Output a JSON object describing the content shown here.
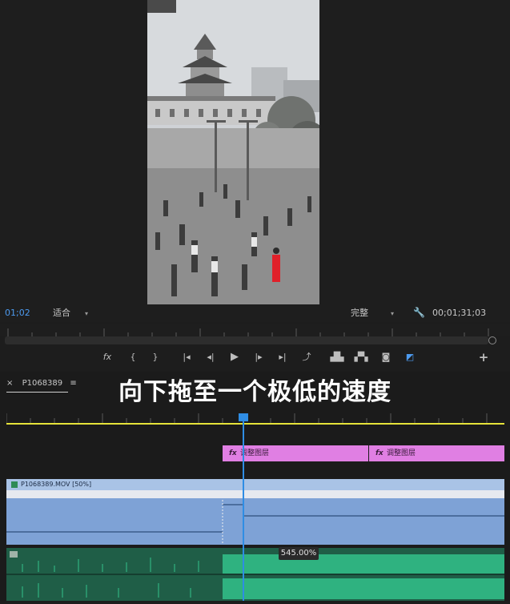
{
  "monitor": {
    "timecode_current": "01;02",
    "fit_label": "适合",
    "quality_label": "完整",
    "timecode_duration": "00;01;31;03",
    "colors": {
      "timecode": "#4d9bf0",
      "accent_red_figure": "#e0202a"
    }
  },
  "transport": {
    "buttons": [
      "fx-icon",
      "mark-in-icon",
      "mark-out-icon",
      "go-to-in-icon",
      "step-back-icon",
      "play-icon",
      "step-forward-icon",
      "go-to-out-icon",
      "lift-icon",
      "extract-icon",
      "export-frame-icon",
      "compare-icon",
      "add-button-icon"
    ]
  },
  "timeline": {
    "tab_close": "×",
    "sequence_name": "P1068389",
    "menu_glyph": "≡",
    "caption": "向下拖至一个极低的速度",
    "adjustment_clip_1": "调整图层",
    "adjustment_clip_2": "调整图层",
    "video_clip_label": "P1068389.MOV [50%]",
    "speed_readout": "545.00%",
    "colors": {
      "adjustment": "#e07fe3",
      "video": "#7ea2d6",
      "audio": "#1f5e47",
      "playhead": "#2f8de4",
      "workarea": "#e6e33a"
    }
  }
}
